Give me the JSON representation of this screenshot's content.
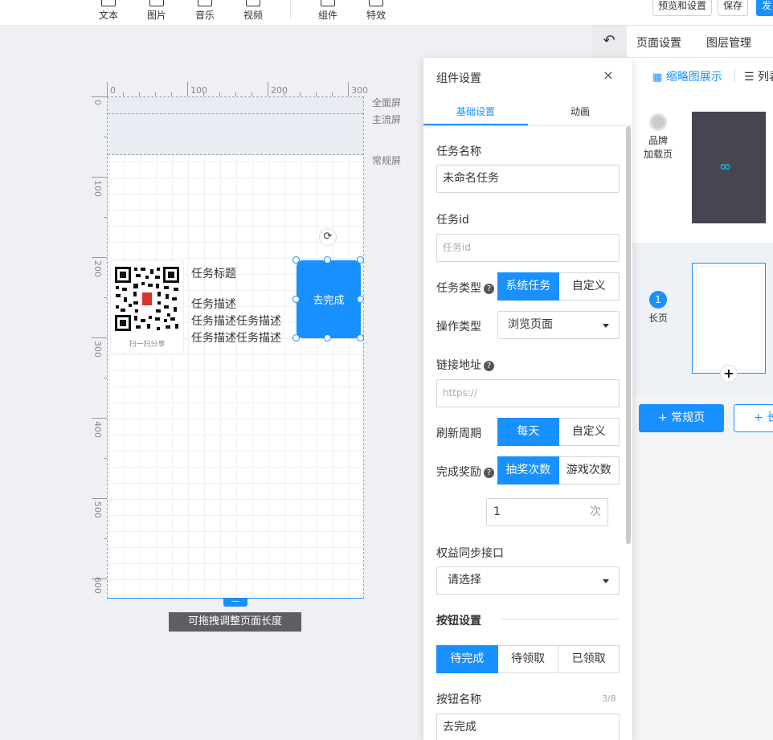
{
  "toolbar": {
    "tools": [
      {
        "label": "文本",
        "icon": "text-icon"
      },
      {
        "label": "图片",
        "icon": "image-icon"
      },
      {
        "label": "音乐",
        "icon": "music-icon"
      },
      {
        "label": "视频",
        "icon": "video-icon"
      },
      {
        "label": "组件",
        "icon": "component-icon"
      },
      {
        "label": "特效",
        "icon": "effects-icon"
      }
    ],
    "preview_label": "预览和设置",
    "save_label": "保存",
    "publish_label": "发"
  },
  "canvas": {
    "ruler_top_labels": [
      "0",
      "100",
      "200",
      "300"
    ],
    "ruler_left_labels": [
      "0",
      "100",
      "200",
      "300",
      "400",
      "500",
      "600"
    ],
    "zones": {
      "full": "全面屏",
      "main": "主流屏",
      "normal": "常规屏"
    },
    "qr_caption": "扫一扫分享",
    "task_title": "任务标题",
    "task_desc_lines": [
      "任务描述",
      "任务描述任务描述",
      "任务描述任务描述"
    ],
    "button_label": "去完成",
    "rotate_icon": "⟳",
    "drag_handle_glyph": "—",
    "drag_tip": "可拖拽调整页面长度"
  },
  "right_panel": {
    "back_icon": "↶",
    "tabs": [
      "页面设置",
      "图层管理"
    ],
    "view_thumbnail": "缩略图展示",
    "view_list": "列表",
    "pages": [
      {
        "label_lines": [
          "品牌",
          "加载页"
        ],
        "index": ""
      },
      {
        "label_lines": [
          "长页"
        ],
        "index": "1"
      }
    ],
    "add_regular": "+ 常规页",
    "add_long": "+ 长页",
    "plus_glyph": "+"
  },
  "dialog": {
    "title": "组件设置",
    "close_glyph": "×",
    "tabs": [
      "基础设置",
      "动画"
    ],
    "task_name_label": "任务名称",
    "task_name_value": "未命名任务",
    "task_id_label": "任务id",
    "task_id_placeholder": "任务id",
    "task_type_label": "任务类型",
    "task_type_options": [
      "系统任务",
      "自定义"
    ],
    "op_type_label": "操作类型",
    "op_type_value": "浏览页面",
    "link_label": "链接地址",
    "link_placeholder": "https://",
    "refresh_label": "刷新周期",
    "refresh_options": [
      "每天",
      "自定义"
    ],
    "reward_label": "完成奖励",
    "reward_options": [
      "抽奖次数",
      "游戏次数"
    ],
    "reward_count": "1",
    "reward_unit": "次",
    "rights_label": "权益同步接口",
    "rights_value": "请选择",
    "btn_section": "按钮设置",
    "btn_state_options": [
      "待完成",
      "待领取",
      "已领取"
    ],
    "btn_name_label": "按钮名称",
    "btn_name_counter": "3/8",
    "btn_name_value": "去完成",
    "help_glyph": "?"
  },
  "colors": {
    "accent": "#1890ff",
    "canvas_bg": "#eef0f3",
    "thumb_dark": "#484550",
    "tip_bg": "#5d5f63"
  }
}
